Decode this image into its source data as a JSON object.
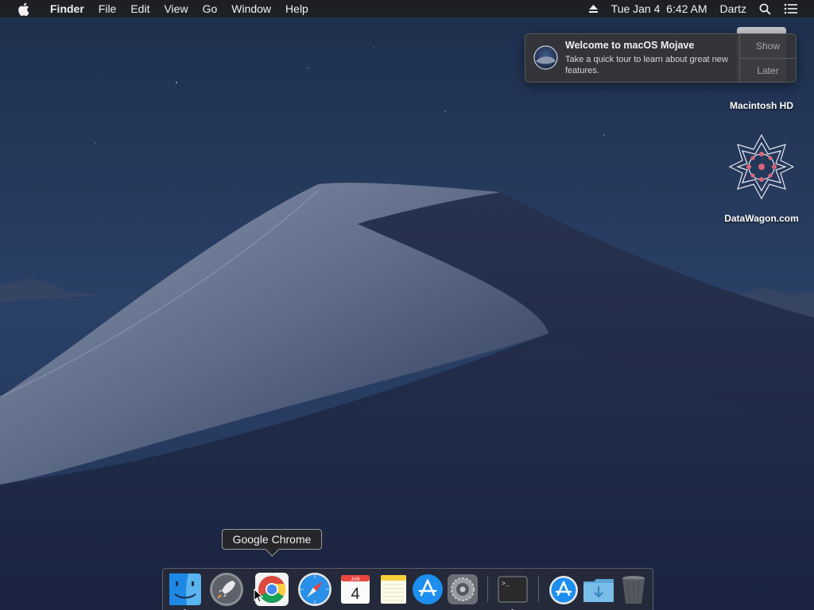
{
  "menubar": {
    "app_name": "Finder",
    "items": [
      "File",
      "Edit",
      "View",
      "Go",
      "Window",
      "Help"
    ],
    "datetime": "Tue Jan 4  6:42 AM",
    "user": "Dartz",
    "icons": [
      "apple-icon",
      "eject-icon",
      "spotlight-icon",
      "notification-center-icon"
    ]
  },
  "notification": {
    "title": "Welcome to macOS Mojave",
    "body": "Take a quick tour to learn about great new features.",
    "show_label": "Show",
    "later_label": "Later"
  },
  "desktop_icons": [
    {
      "label": "Macintosh HD",
      "icon": "hard-drive-icon"
    },
    {
      "label": "DataWagon.com",
      "icon": "datawagon-icon"
    }
  ],
  "tooltip": {
    "text": "Google Chrome"
  },
  "dock": {
    "items": [
      {
        "name": "Finder",
        "icon": "finder-icon",
        "running": true
      },
      {
        "name": "Launchpad",
        "icon": "launchpad-icon",
        "running": false
      },
      {
        "name": "Google Chrome",
        "icon": "chrome-icon",
        "running": false
      },
      {
        "name": "Safari",
        "icon": "safari-icon",
        "running": false
      },
      {
        "name": "Calendar",
        "icon": "calendar-icon",
        "running": false,
        "month": "JAN",
        "day": "4"
      },
      {
        "name": "Notes",
        "icon": "notes-icon",
        "running": false
      },
      {
        "name": "App Store",
        "icon": "app-store-icon",
        "running": false
      },
      {
        "name": "System Preferences",
        "icon": "system-preferences-icon",
        "running": false
      },
      {
        "name": "Terminal",
        "icon": "terminal-icon",
        "running": true
      },
      {
        "name": "Applications",
        "icon": "applications-folder-icon",
        "running": false
      },
      {
        "name": "Downloads",
        "icon": "downloads-folder-icon",
        "running": false
      },
      {
        "name": "Trash",
        "icon": "trash-icon",
        "running": false
      }
    ]
  },
  "colors": {
    "menubar_bg": "#1e1e20",
    "notification_bg": "#343438",
    "wallpaper_sky": "#253a5c"
  }
}
